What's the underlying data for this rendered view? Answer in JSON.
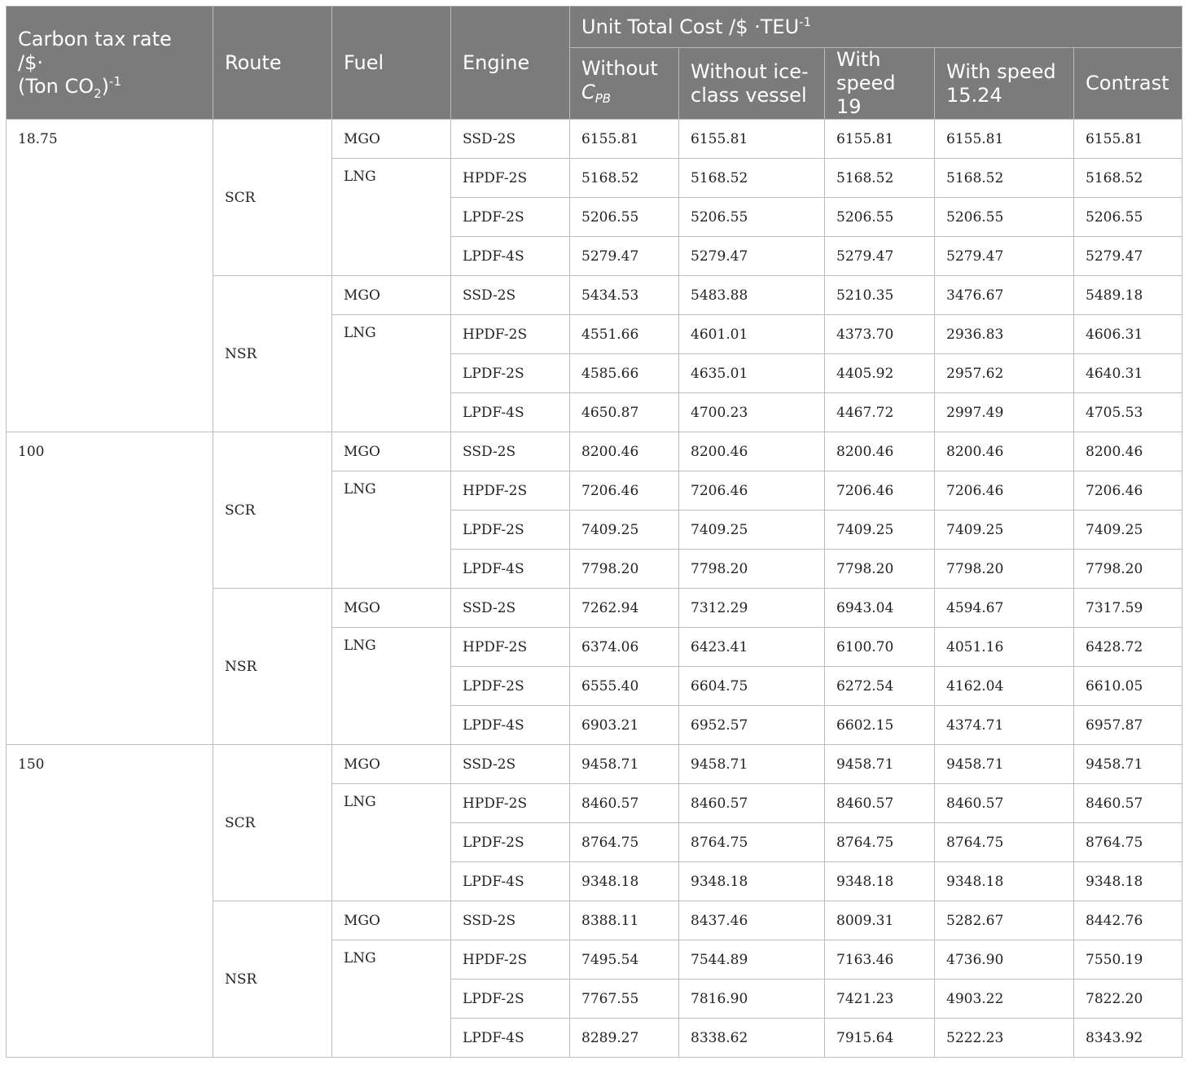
{
  "header": {
    "carbon_tax_title": "Carbon tax rate /$·",
    "carbon_tax_unit_pre": "(Ton CO",
    "carbon_tax_unit_sub": "2",
    "carbon_tax_unit_post": ")",
    "carbon_tax_unit_sup": "-1",
    "route": "Route",
    "fuel": "Fuel",
    "engine": "Engine",
    "unit_cost": "Unit Total Cost /$ ·TEU",
    "unit_cost_sup": "-1",
    "col_without": "Without",
    "col_cpb_main": "C",
    "col_cpb_sub": "PB",
    "col_iceclass": "Without ice-class vessel",
    "col_speed19": "With speed 19",
    "col_speed1524": "With speed 15.24",
    "col_contrast": "Contrast"
  },
  "groups": [
    {
      "rate": "18.75",
      "routes": [
        {
          "route": "SCR",
          "rows": [
            {
              "fuel": "MGO",
              "engine": "SSD-2S",
              "values": [
                "6155.81",
                "6155.81",
                "6155.81",
                "6155.81",
                "6155.81"
              ]
            },
            {
              "fuel": "LNG",
              "engine": "HPDF-2S",
              "values": [
                "5168.52",
                "5168.52",
                "5168.52",
                "5168.52",
                "5168.52"
              ]
            },
            {
              "engine": "LPDF-2S",
              "values": [
                "5206.55",
                "5206.55",
                "5206.55",
                "5206.55",
                "5206.55"
              ]
            },
            {
              "engine": "LPDF-4S",
              "values": [
                "5279.47",
                "5279.47",
                "5279.47",
                "5279.47",
                "5279.47"
              ]
            }
          ]
        },
        {
          "route": "NSR",
          "rows": [
            {
              "fuel": "MGO",
              "engine": "SSD-2S",
              "values": [
                "5434.53",
                "5483.88",
                "5210.35",
                "3476.67",
                "5489.18"
              ]
            },
            {
              "fuel": "LNG",
              "engine": "HPDF-2S",
              "values": [
                "4551.66",
                "4601.01",
                "4373.70",
                "2936.83",
                "4606.31"
              ]
            },
            {
              "engine": "LPDF-2S",
              "values": [
                "4585.66",
                "4635.01",
                "4405.92",
                "2957.62",
                "4640.31"
              ]
            },
            {
              "engine": "LPDF-4S",
              "values": [
                "4650.87",
                "4700.23",
                "4467.72",
                "2997.49",
                "4705.53"
              ]
            }
          ]
        }
      ]
    },
    {
      "rate": "100",
      "routes": [
        {
          "route": "SCR",
          "rows": [
            {
              "fuel": "MGO",
              "engine": "SSD-2S",
              "values": [
                "8200.46",
                "8200.46",
                "8200.46",
                "8200.46",
                "8200.46"
              ]
            },
            {
              "fuel": "LNG",
              "engine": "HPDF-2S",
              "values": [
                "7206.46",
                "7206.46",
                "7206.46",
                "7206.46",
                "7206.46"
              ]
            },
            {
              "engine": "LPDF-2S",
              "values": [
                "7409.25",
                "7409.25",
                "7409.25",
                "7409.25",
                "7409.25"
              ]
            },
            {
              "engine": "LPDF-4S",
              "values": [
                "7798.20",
                "7798.20",
                "7798.20",
                "7798.20",
                "7798.20"
              ]
            }
          ]
        },
        {
          "route": "NSR",
          "rows": [
            {
              "fuel": "MGO",
              "engine": "SSD-2S",
              "values": [
                "7262.94",
                "7312.29",
                "6943.04",
                "4594.67",
                "7317.59"
              ]
            },
            {
              "fuel": "LNG",
              "engine": "HPDF-2S",
              "values": [
                "6374.06",
                "6423.41",
                "6100.70",
                "4051.16",
                "6428.72"
              ]
            },
            {
              "engine": "LPDF-2S",
              "values": [
                "6555.40",
                "6604.75",
                "6272.54",
                "4162.04",
                "6610.05"
              ]
            },
            {
              "engine": "LPDF-4S",
              "values": [
                "6903.21",
                "6952.57",
                "6602.15",
                "4374.71",
                "6957.87"
              ]
            }
          ]
        }
      ]
    },
    {
      "rate": "150",
      "routes": [
        {
          "route": "SCR",
          "rows": [
            {
              "fuel": "MGO",
              "engine": "SSD-2S",
              "values": [
                "9458.71",
                "9458.71",
                "9458.71",
                "9458.71",
                "9458.71"
              ]
            },
            {
              "fuel": "LNG",
              "engine": "HPDF-2S",
              "values": [
                "8460.57",
                "8460.57",
                "8460.57",
                "8460.57",
                "8460.57"
              ]
            },
            {
              "engine": "LPDF-2S",
              "values": [
                "8764.75",
                "8764.75",
                "8764.75",
                "8764.75",
                "8764.75"
              ]
            },
            {
              "engine": "LPDF-4S",
              "values": [
                "9348.18",
                "9348.18",
                "9348.18",
                "9348.18",
                "9348.18"
              ]
            }
          ]
        },
        {
          "route": "NSR",
          "rows": [
            {
              "fuel": "MGO",
              "engine": "SSD-2S",
              "values": [
                "8388.11",
                "8437.46",
                "8009.31",
                "5282.67",
                "8442.76"
              ]
            },
            {
              "fuel": "LNG",
              "engine": "HPDF-2S",
              "values": [
                "7495.54",
                "7544.89",
                "7163.46",
                "4736.90",
                "7550.19"
              ]
            },
            {
              "engine": "LPDF-2S",
              "values": [
                "7767.55",
                "7816.90",
                "7421.23",
                "4903.22",
                "7822.20"
              ]
            },
            {
              "engine": "LPDF-4S",
              "values": [
                "8289.27",
                "8338.62",
                "7915.64",
                "5222.23",
                "8343.92"
              ]
            }
          ]
        }
      ]
    }
  ]
}
